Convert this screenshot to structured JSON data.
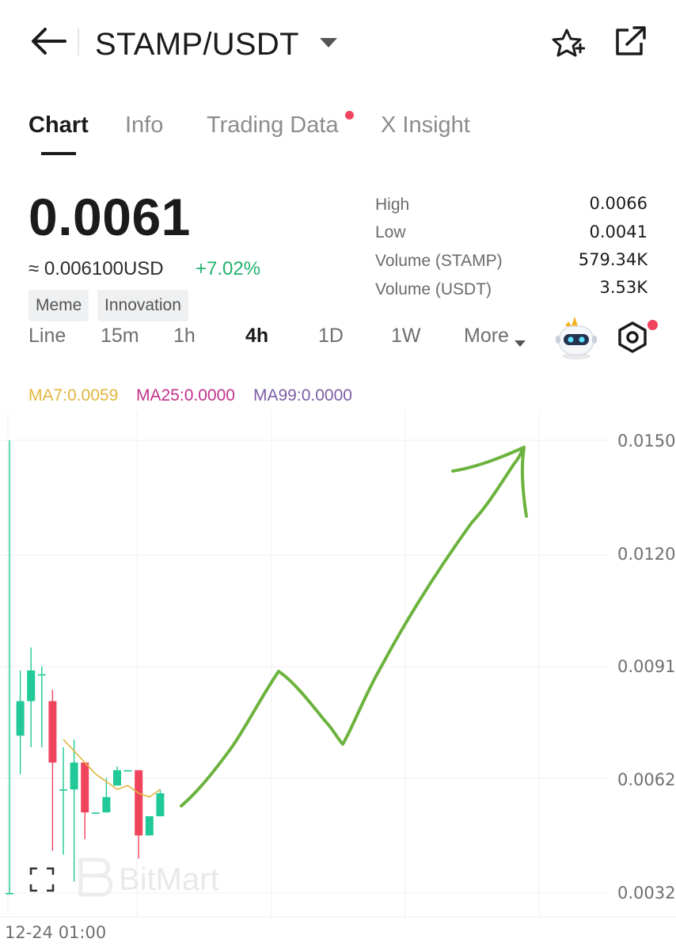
{
  "header": {
    "pair": "STAMP/USDT"
  },
  "tabs": [
    {
      "label": "Chart",
      "active": true
    },
    {
      "label": "Info",
      "active": false
    },
    {
      "label": "Trading Data",
      "active": false,
      "notification": true
    },
    {
      "label": "X Insight",
      "active": false
    }
  ],
  "ticker": {
    "price": "0.0061",
    "usd_equivalent": "≈ 0.006100USD",
    "change": "+7.02%",
    "tags": [
      "Meme",
      "Innovation"
    ],
    "stats": [
      {
        "label": "High",
        "value": "0.0066"
      },
      {
        "label": "Low",
        "value": "0.0041"
      },
      {
        "label": "Volume (STAMP)",
        "value": "579.34K"
      },
      {
        "label": "Volume (USDT)",
        "value": "3.53K"
      }
    ]
  },
  "intervals": [
    {
      "label": "Line",
      "active": false
    },
    {
      "label": "15m",
      "active": false
    },
    {
      "label": "1h",
      "active": false
    },
    {
      "label": "4h",
      "active": true
    },
    {
      "label": "1D",
      "active": false
    },
    {
      "label": "1W",
      "active": false
    },
    {
      "label": "More",
      "active": false
    }
  ],
  "moving_averages": [
    {
      "label": "MA7:0.0059",
      "color": "#e2b63c"
    },
    {
      "label": "MA25:0.0000",
      "color": "#c2318c"
    },
    {
      "label": "MA99:0.0000",
      "color": "#7b5ea6"
    }
  ],
  "watermark": "BitMart",
  "colors": {
    "up": "#20c997",
    "down": "#f0435c",
    "accent_green": "#20b26c",
    "drawing": "#6cb33e"
  },
  "chart_data": {
    "type": "candlestick",
    "y_ticks": [
      "0.0150",
      "0.0120",
      "0.0091",
      "0.0062",
      "0.0032"
    ],
    "ylim": [
      0.0032,
      0.015
    ],
    "x_tick_labels": [
      "12-24 01:00"
    ],
    "candles": [
      {
        "open": 0.0032,
        "high": 0.015,
        "low": 0.0032,
        "close": 0.0032
      },
      {
        "open": 0.0073,
        "high": 0.009,
        "low": 0.0063,
        "close": 0.0082
      },
      {
        "open": 0.0082,
        "high": 0.0096,
        "low": 0.007,
        "close": 0.009
      },
      {
        "open": 0.0089,
        "high": 0.0091,
        "low": 0.007,
        "close": 0.0089
      },
      {
        "open": 0.0082,
        "high": 0.0085,
        "low": 0.0043,
        "close": 0.0066
      },
      {
        "open": 0.0059,
        "high": 0.007,
        "low": 0.0042,
        "close": 0.0059
      },
      {
        "open": 0.0059,
        "high": 0.0072,
        "low": 0.0035,
        "close": 0.0066
      },
      {
        "open": 0.0066,
        "high": 0.0066,
        "low": 0.0046,
        "close": 0.0053
      },
      {
        "open": 0.0053,
        "high": 0.0053,
        "low": 0.0053,
        "close": 0.0053
      },
      {
        "open": 0.0053,
        "high": 0.0062,
        "low": 0.0053,
        "close": 0.0057
      },
      {
        "open": 0.006,
        "high": 0.0065,
        "low": 0.006,
        "close": 0.0064
      },
      {
        "open": 0.0064,
        "high": 0.0064,
        "low": 0.0064,
        "close": 0.0064
      },
      {
        "open": 0.0064,
        "high": 0.0064,
        "low": 0.0041,
        "close": 0.0047
      },
      {
        "open": 0.0047,
        "high": 0.0052,
        "low": 0.0047,
        "close": 0.0052
      },
      {
        "open": 0.0052,
        "high": 0.0059,
        "low": 0.0052,
        "close": 0.0058
      }
    ],
    "ma7": [
      0.0072,
      0.0069,
      0.0066,
      0.0063,
      0.0061,
      0.0059,
      0.006,
      0.0058,
      0.0057,
      0.0059
    ],
    "ma7_start_index": 5
  }
}
